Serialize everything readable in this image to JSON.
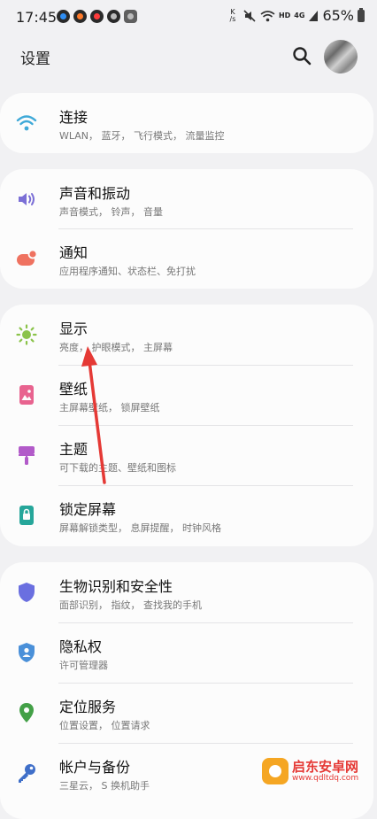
{
  "status_bar": {
    "time": "17:45",
    "speed_top": "K",
    "speed_bottom": "/s",
    "hd": "HD",
    "network": "4G",
    "battery": "65%"
  },
  "header": {
    "title": "设置"
  },
  "groups": [
    {
      "items": [
        {
          "title": "连接",
          "subtitle": "WLAN， 蓝牙， 飞行模式， 流量监控",
          "icon": "wifi-icon",
          "color": "#3fa9d8"
        }
      ]
    },
    {
      "items": [
        {
          "title": "声音和振动",
          "subtitle": "声音模式， 铃声， 音量",
          "icon": "speaker-icon",
          "color": "#7b6fd6"
        },
        {
          "title": "通知",
          "subtitle": "应用程序通知、状态栏、免打扰",
          "icon": "notification-icon",
          "color": "#ef7260"
        }
      ]
    },
    {
      "items": [
        {
          "title": "显示",
          "subtitle": "亮度， 护眼模式， 主屏幕",
          "icon": "brightness-icon",
          "color": "#8bc34a"
        },
        {
          "title": "壁纸",
          "subtitle": "主屏幕壁纸， 锁屏壁纸",
          "icon": "wallpaper-icon",
          "color": "#e8638f"
        },
        {
          "title": "主题",
          "subtitle": "可下载的主题、壁纸和图标",
          "icon": "theme-icon",
          "color": "#b25bc9"
        },
        {
          "title": "锁定屏幕",
          "subtitle": "屏幕解锁类型， 息屏提醒， 时钟风格",
          "icon": "lock-screen-icon",
          "color": "#26a69a"
        }
      ]
    },
    {
      "items": [
        {
          "title": "生物识别和安全性",
          "subtitle": "面部识别， 指纹， 查找我的手机",
          "icon": "shield-icon",
          "color": "#6a6fe0"
        },
        {
          "title": "隐私权",
          "subtitle": "许可管理器",
          "icon": "privacy-icon",
          "color": "#4a90d9"
        },
        {
          "title": "定位服务",
          "subtitle": "位置设置， 位置请求",
          "icon": "location-icon",
          "color": "#43a047"
        },
        {
          "title": "帐户与备份",
          "subtitle": "三星云， S 换机助手",
          "icon": "key-icon",
          "color": "#3f6fc9"
        }
      ]
    }
  ],
  "watermark": {
    "name": "启东安卓网",
    "url": "www.qdltdq.com"
  }
}
